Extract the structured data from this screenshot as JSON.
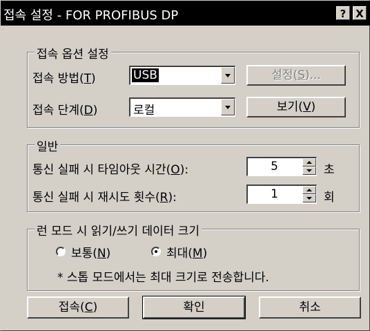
{
  "window": {
    "title": "접속 설정 - FOR PROFIBUS DP",
    "help_btn": "?",
    "close_btn": "X"
  },
  "connection_options": {
    "legend": "접속 옵션 설정",
    "method_label": "접속 방법(",
    "method_key": "T",
    "method_value": "USB",
    "settings_btn_text": "설정(",
    "settings_btn_key": "S",
    "settings_btn_tail": ")...",
    "step_label": "접속 단계(",
    "step_key": "D",
    "step_value": "로컬",
    "view_btn_text": "보기(",
    "view_btn_key": "V"
  },
  "general": {
    "legend": "일반",
    "timeout_label": "통신 실패 시 타임아웃 시간(",
    "timeout_key": "O",
    "timeout_tail": "):",
    "timeout_value": "5",
    "timeout_unit": "초",
    "retry_label": "통신 실패 시 재시도 횟수(",
    "retry_key": "R",
    "retry_tail": "):",
    "retry_value": "1",
    "retry_unit": "회"
  },
  "run_mode": {
    "legend": "런 모드 시 읽기/쓰기 데이터 크기",
    "normal_label": "보통(",
    "normal_key": "N",
    "normal_tail": ")",
    "max_label": "최대(",
    "max_key": "M",
    "note": "* 스톱 모드에서는 최대 크기로 전송합니다."
  },
  "footer": {
    "connect_text": "접속(",
    "connect_key": "C",
    "ok": "확인",
    "cancel": "취소"
  },
  "paren_close": ")"
}
